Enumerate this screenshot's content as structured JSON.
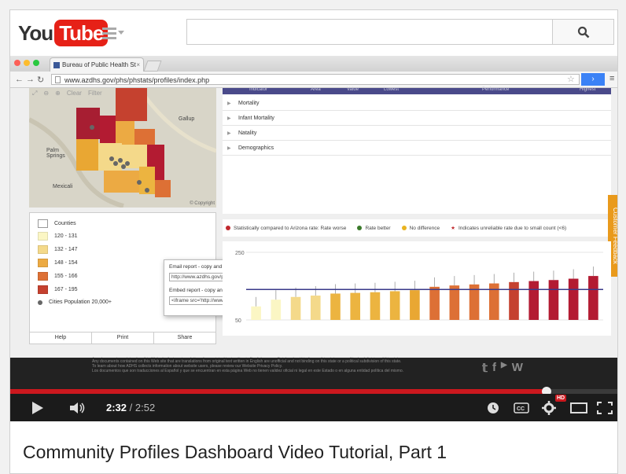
{
  "youtube": {
    "logo_you": "You",
    "logo_tube": "Tube"
  },
  "browser": {
    "tab_title": "Bureau of Public Health St",
    "url": "www.azdhs.gov/phs/phstats/profiles/index.php"
  },
  "map": {
    "tools": [
      "Clear",
      "Filter"
    ],
    "places": [
      "Gallup",
      "Palm Springs",
      "Mexicali"
    ],
    "copyright": "© Copyright"
  },
  "legend": {
    "title": "Counties",
    "items": [
      {
        "label": "120 - 131",
        "color": "#fbf6c4"
      },
      {
        "label": "132 - 147",
        "color": "#f4d98a"
      },
      {
        "label": "148 - 154",
        "color": "#ecaa43"
      },
      {
        "label": "155 - 166",
        "color": "#dd7035"
      },
      {
        "label": "167 - 195",
        "color": "#c5412f"
      }
    ],
    "cities": "Cities Population 20,000+",
    "tabs": [
      "Help",
      "Print",
      "Share"
    ]
  },
  "share_popup": {
    "email_label": "Email report - copy and paste link into email",
    "email_value": "http://www.azdhs.gov/phs/phstats/profiles/",
    "embed_label": "Embed report - copy and paste html into web page",
    "embed_value": "<iframe src='http://www.azdhs.gov/phs/pl"
  },
  "table": {
    "headers": [
      "Indicator",
      "Area",
      "Value",
      "Lowest",
      "Performance",
      "Highest"
    ],
    "rows": [
      "Mortality",
      "Infant Mortality",
      "Natality",
      "Demographics"
    ]
  },
  "key": {
    "items": [
      {
        "label": "Statistically compared to Arizona rate: Rate worse",
        "color": "#c0282d"
      },
      {
        "label": "Rate better",
        "color": "#3a7a2a"
      },
      {
        "label": "No difference",
        "color": "#e9b320"
      }
    ],
    "unreliable": "Indicates unreliable rate due to small count (<6)"
  },
  "feedback_label": "Customer Feedback",
  "chart_data": {
    "type": "bar",
    "yticks": [
      50,
      250
    ],
    "ylim": [
      50,
      250
    ],
    "reference": 140,
    "values": [
      90,
      110,
      118,
      122,
      128,
      130,
      132,
      135,
      138,
      148,
      152,
      155,
      158,
      162,
      165,
      168,
      172,
      180
    ],
    "colors": [
      "#fbf6c4",
      "#fbf6c4",
      "#f4d98a",
      "#f4d98a",
      "#ecb440",
      "#ecb440",
      "#ecb440",
      "#ecb440",
      "#e9a733",
      "#dd7035",
      "#dd7035",
      "#dd7035",
      "#dd7035",
      "#c5412f",
      "#b31b32",
      "#b31b32",
      "#b31b32",
      "#b31b32"
    ]
  },
  "footer": {
    "line1": "Any documents contained on this Web site that are translations from original text written in English are unofficial and not binding on this state or a political subdivision of this state.",
    "line2": "To learn about how ADHS collects information about website users, please review our Website Privacy Policy.",
    "line3": "Los documentos que son traducciones al Español y que se encuentran en esta página Web no tienen validez oficial ni legal en este Estado o en alguna entidad política del mismo."
  },
  "player": {
    "current_time": "2:32",
    "separator": " / ",
    "duration": "2:52",
    "progress": 0.883,
    "hd_label": "HD"
  },
  "video_title": "Community Profiles Dashboard Video Tutorial, Part 1"
}
